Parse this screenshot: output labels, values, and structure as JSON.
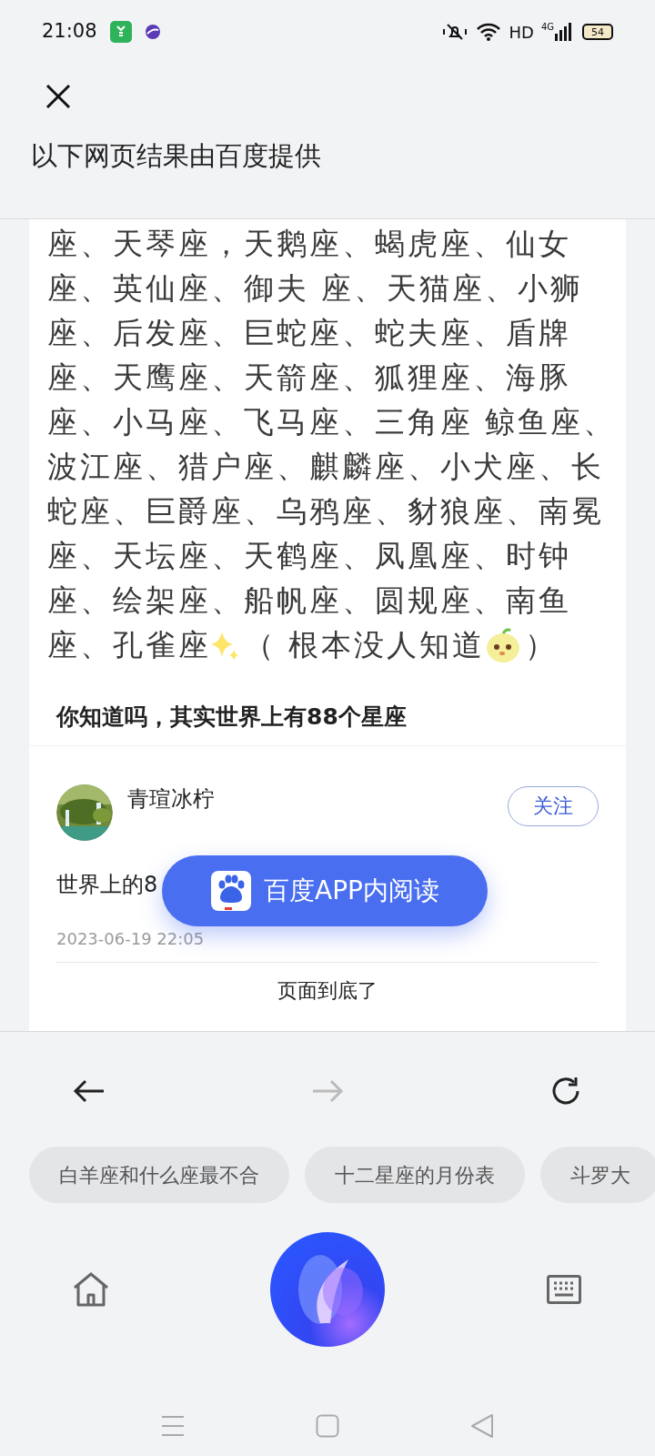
{
  "status_bar": {
    "time": "21:08",
    "hd": "HD",
    "network": "4G",
    "battery": "54"
  },
  "header": {
    "title": "以下网页结果由百度提供"
  },
  "post_image": {
    "lines": [
      "座、天琴座，天鹅座、蝎虎座、仙女",
      "座、英仙座、御夫 座、天猫座、小狮",
      "座、后发座、巨蛇座、蛇夫座、盾牌",
      "座、天鹰座、天箭座、狐狸座、海豚",
      "座、小马座、飞马座、三角座 鲸鱼座、",
      "波江座、猎户座、麒麟座、小犬座、长",
      "蛇座、巨爵座、乌鸦座、豺狼座、南冕",
      "座、天坛座、天鹤座、凤凰座、时钟",
      "座、绘架座、船帆座、圆规座、南鱼"
    ],
    "last_line_start": "座、孔雀座",
    "last_line_end": "（ 根本没人知道",
    "last_line_close": "）",
    "caption": "你知道吗，其实世界上有88个星座"
  },
  "author": {
    "name": "青瑄冰柠",
    "follow": "关注"
  },
  "post": {
    "excerpt": "世界上的8",
    "date": "2023-06-19 22:05"
  },
  "app_banner": {
    "label": "百度APP内阅读"
  },
  "end_note": "页面到底了",
  "nav": {
    "back_enabled": true,
    "forward_enabled": false
  },
  "suggestions": [
    "白羊座和什么座最不合",
    "十二星座的月份表",
    "斗罗大"
  ]
}
